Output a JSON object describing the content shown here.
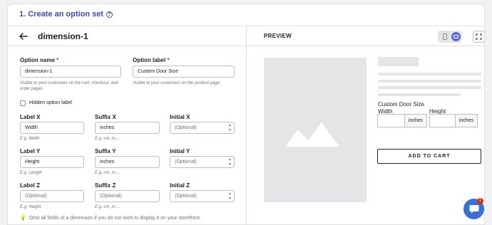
{
  "section": {
    "title": "1. Create an option set",
    "help_icon": "question-circle-icon"
  },
  "editor": {
    "back_icon": "arrow-left-icon",
    "dimension_title": "dimension-1",
    "option_name": {
      "label": "Option name",
      "required": "*",
      "value": "dimension-1",
      "hint": "Visible to your customers on the cart, checkout, and order pages"
    },
    "option_label": {
      "label": "Option label",
      "required": "*",
      "value": "Custom Door Size",
      "hint": "Visible to your customers on the product page"
    },
    "hidden_label": {
      "label": "Hidden option label",
      "checked": false
    },
    "x": {
      "label": {
        "label": "Label X",
        "value": "Width",
        "hint": "E.g. Width"
      },
      "suffix": {
        "label": "Suffix X",
        "value": "inches",
        "hint": "E.g. cm, m,..."
      },
      "initial": {
        "label": "Initial X",
        "placeholder": "(Optional)"
      }
    },
    "y": {
      "label": {
        "label": "Label Y",
        "value": "Height",
        "hint": "E.g. Length"
      },
      "suffix": {
        "label": "Suffix Y",
        "value": "inches",
        "hint": "E.g. cm, m,..."
      },
      "initial": {
        "label": "Initial Y",
        "placeholder": "(Optional)"
      }
    },
    "z": {
      "label": {
        "label": "Label Z",
        "placeholder": "(Optional)",
        "hint": "E.g. Height"
      },
      "suffix": {
        "label": "Suffix Z",
        "placeholder": "(Optional)",
        "hint": "E.g. cm, m,..."
      },
      "initial": {
        "label": "Initial Z",
        "placeholder": "(Optional)"
      }
    },
    "tip": "Omit all fields of a dimension if you do not wish to display it on your storefront."
  },
  "preview": {
    "label": "PREVIEW",
    "device": "desktop",
    "option_title": "Custom Door Size",
    "width_label": "Width",
    "height_label": "Height",
    "width_suffix": "inches",
    "height_suffix": "inches",
    "add_to_cart": "ADD TO CART"
  },
  "chat": {
    "badge": "1"
  },
  "colors": {
    "accent": "#3a4bbf",
    "toggle": "#5a6be0",
    "chat": "#3b6fd8",
    "badge": "#d72c0d"
  }
}
